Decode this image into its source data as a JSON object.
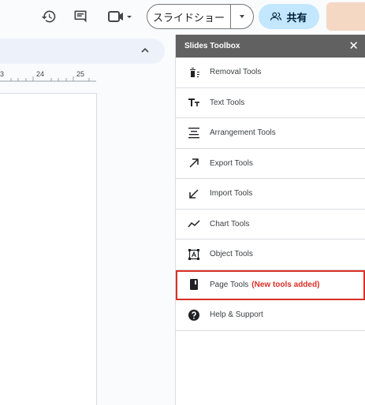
{
  "toolbar": {
    "history_icon": "history-icon",
    "comment_icon": "comment-icon",
    "video_icon": "video-icon",
    "slideshow_label": "スライドショー",
    "share_label": "共有"
  },
  "ruler": {
    "ticks": [
      "3",
      "24",
      "25"
    ]
  },
  "panel": {
    "title": "Slides Toolbox",
    "close": "✕",
    "items": [
      {
        "label": "Removal Tools",
        "icon": "trash-icon"
      },
      {
        "label": "Text Tools",
        "icon": "text-icon"
      },
      {
        "label": "Arrangement Tools",
        "icon": "align-icon"
      },
      {
        "label": "Export Tools",
        "icon": "export-arrow-icon"
      },
      {
        "label": "Import Tools",
        "icon": "import-arrow-icon"
      },
      {
        "label": "Chart Tools",
        "icon": "chart-line-icon"
      },
      {
        "label": "Object Tools",
        "icon": "object-icon"
      },
      {
        "label": "Page Tools",
        "badge": "(New tools added)",
        "icon": "page-icon"
      },
      {
        "label": "Help & Support",
        "icon": "help-icon"
      }
    ]
  },
  "colors": {
    "accent": "#c2e7ff",
    "highlight": "#d93025",
    "panel_header": "#616161"
  }
}
